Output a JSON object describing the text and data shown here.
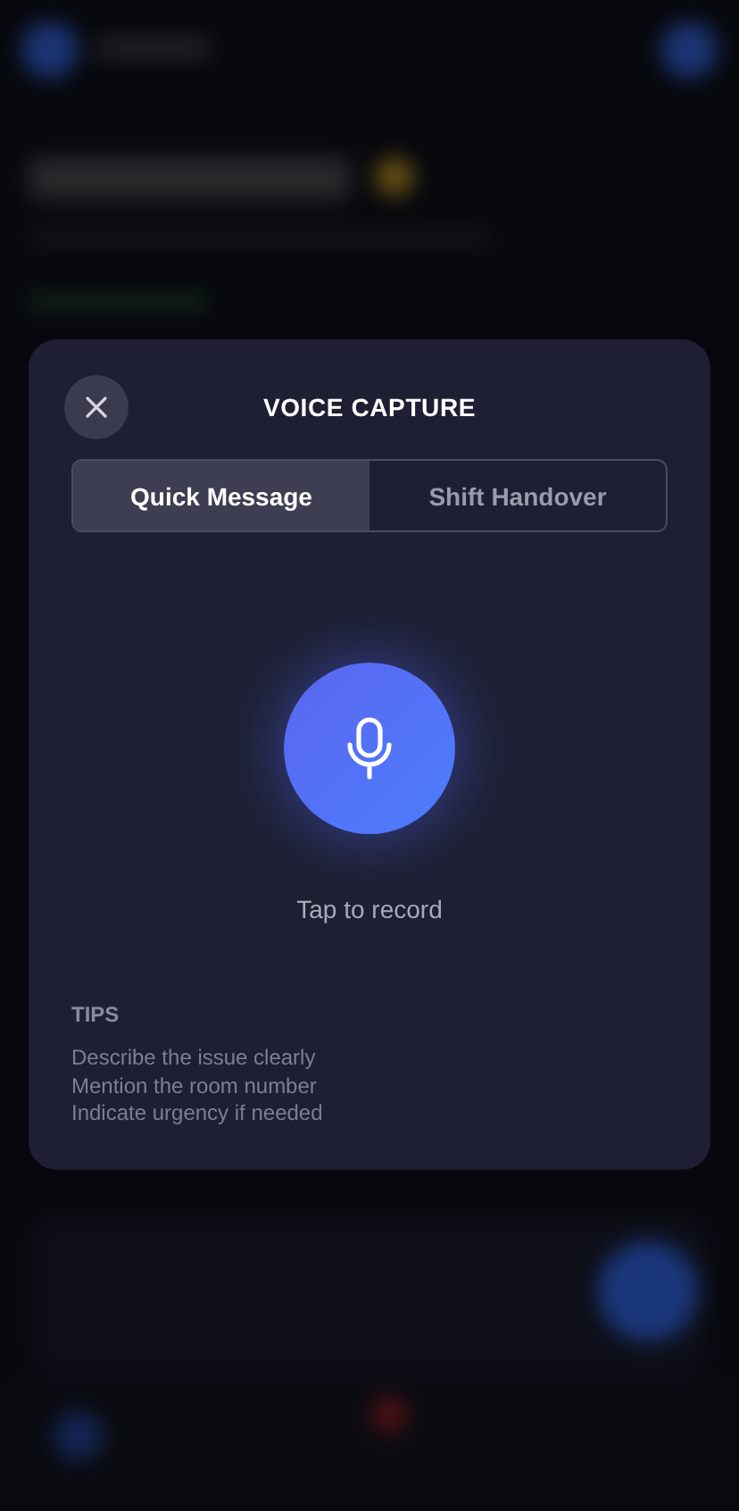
{
  "modal": {
    "title": "VOICE CAPTURE",
    "tabs": [
      {
        "label": "Quick Message",
        "selected": true
      },
      {
        "label": "Shift Handover",
        "selected": false
      }
    ],
    "record_hint": "Tap to record",
    "tips": {
      "heading": "TIPS",
      "items": [
        "Describe the issue clearly",
        "Mention the room number",
        "Indicate urgency if needed"
      ]
    }
  }
}
